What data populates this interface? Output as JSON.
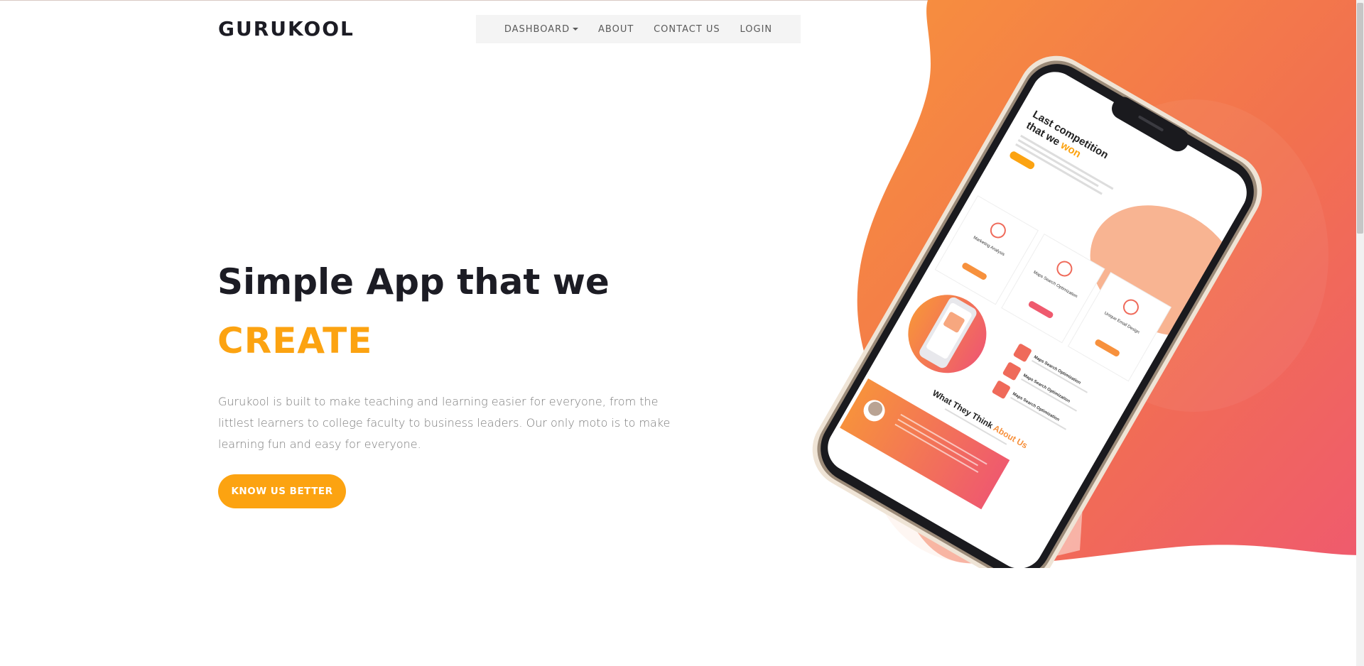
{
  "brand": {
    "name": "GURUKOOL"
  },
  "nav": {
    "items": [
      {
        "label": "DASHBOARD",
        "has_dropdown": true
      },
      {
        "label": "ABOUT"
      },
      {
        "label": "CONTACT US"
      },
      {
        "label": "LOGIN"
      }
    ]
  },
  "hero": {
    "title": "Simple App that we",
    "accent": "CREATE",
    "description": "Gurukool is built to make teaching and learning easier for everyone, from the littlest learners to college faculty to business leaders. Our only moto is to make learning fun and easy for everyone.",
    "cta_label": "KNOW US BETTER"
  },
  "mockup": {
    "heading_line1": "Last competition",
    "heading_line2_prefix": "that we ",
    "heading_line2_accent": "won",
    "cards": [
      "Marketing Analysis",
      "Maps Search Optimization",
      "Unique Email Design"
    ],
    "list_items": [
      "Maps Search Optimization",
      "Maps Search Optimization",
      "Maps Search Optimization"
    ],
    "testimonial_title_prefix": "What They Think ",
    "testimonial_title_accent": "About Us"
  },
  "colors": {
    "accent": "#fca311",
    "dark_text": "#1c1c24",
    "gradient_start": "#f7913d",
    "gradient_end": "#ef5a6e",
    "nav_bg": "#f4f4f4"
  }
}
